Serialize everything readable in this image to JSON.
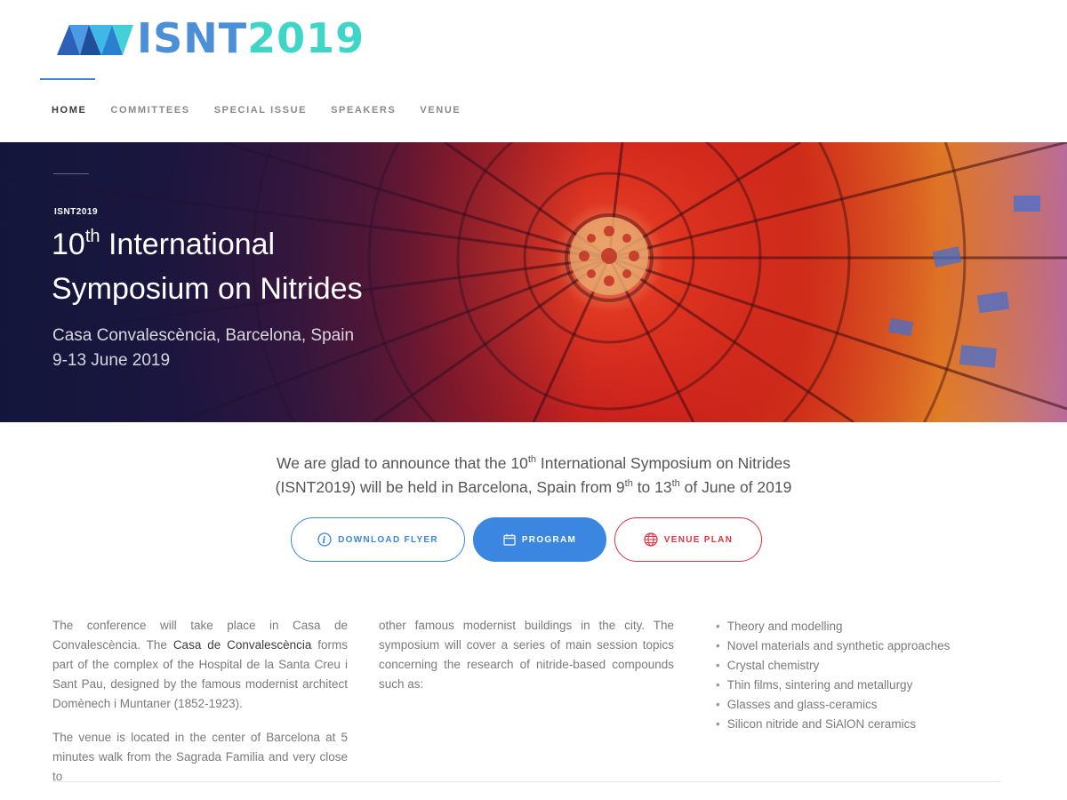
{
  "logo": {
    "text_part1": "ISNT",
    "text_part2": "2019",
    "color_part1": "#4a8fd8",
    "color_part2": "#3fd6c8"
  },
  "nav": {
    "items": [
      {
        "label": "HOME",
        "active": true
      },
      {
        "label": "COMMITTEES",
        "active": false
      },
      {
        "label": "SPECIAL ISSUE",
        "active": false
      },
      {
        "label": "SPEAKERS",
        "active": false
      },
      {
        "label": "VENUE",
        "active": false
      }
    ]
  },
  "hero": {
    "tag": "ISNT2019",
    "title_number": "10",
    "title_suffix": "th",
    "title_line1_rest": " International",
    "title_line2": "Symposium on Nitrides",
    "location": "Casa Convalescència, Barcelona, Spain",
    "dates": "9-13 June  2019"
  },
  "intro": {
    "l1_a": "We are glad to announce that the 10",
    "l1_sup": "th",
    "l1_b": " International Symposium on Nitrides",
    "l2_a": "(ISNT2019) will be held in Barcelona, Spain from 9",
    "l2_sup1": "th",
    "l2_b": " to 13",
    "l2_sup2": "th",
    "l2_c": " of June of 2019"
  },
  "buttons": {
    "flyer": "DOWNLOAD FLYER",
    "program": "PROGRAM",
    "venue": "VENUE PLAN",
    "colors": {
      "blue": "#3a86e0",
      "red": "#e0333f"
    }
  },
  "body": {
    "p1_a": "The conference will take place in Casa de Convalescència. The ",
    "p1_strong": "Casa de Convalescència",
    "p1_b": "  forms part of the complex of the Hospital de la Santa Creu i Sant Pau, designed by the famous modernist architect Domènech i Muntaner (1852-1923).",
    "p2": "The venue is located in the center of Barcelona at 5 minutes walk from the Sagrada Familia and very close to",
    "col2": "other famous modernist buildings in the city. The symposium will cover a series of main session topics concerning the research of nitride-based compounds such as:"
  },
  "topics": [
    "Theory and modelling",
    "Novel materials and synthetic approaches",
    "Crystal chemistry",
    "Thin films, sintering and metallurgy",
    "Glasses and glass-ceramics",
    "Silicon nitride and SiAlON ceramics"
  ]
}
